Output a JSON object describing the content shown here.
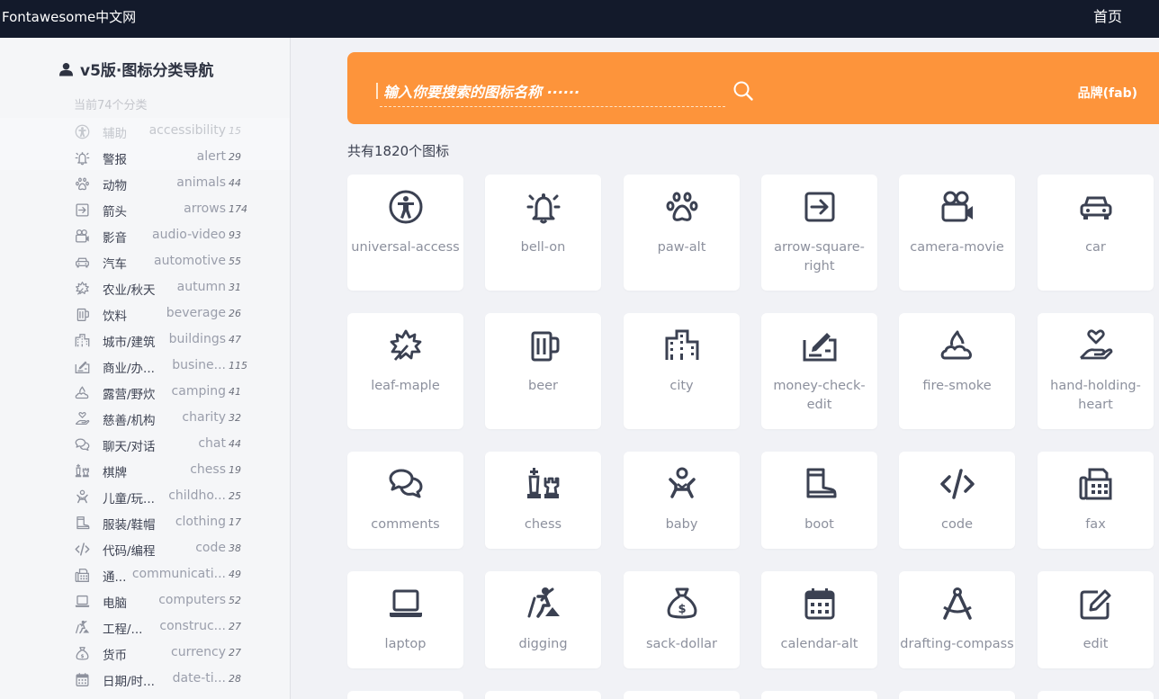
{
  "header": {
    "brand": "Fontawesome中文网",
    "home": "首页"
  },
  "sidebar": {
    "title": "v5版·图标分类导航",
    "count_label": "当前74个分类",
    "categories": [
      {
        "cn": "辅助",
        "en": "accessibility",
        "count": "15",
        "icon": "universal-access-icon"
      },
      {
        "cn": "警报",
        "en": "alert",
        "count": "29",
        "icon": "bell-icon"
      },
      {
        "cn": "动物",
        "en": "animals",
        "count": "44",
        "icon": "paw-icon"
      },
      {
        "cn": "箭头",
        "en": "arrows",
        "count": "174",
        "icon": "arrow-square-right-icon"
      },
      {
        "cn": "影音",
        "en": "audio-video",
        "count": "93",
        "icon": "camera-movie-icon"
      },
      {
        "cn": "汽车",
        "en": "automotive",
        "count": "55",
        "icon": "car-icon"
      },
      {
        "cn": "农业/秋天",
        "en": "autumn",
        "count": "31",
        "icon": "leaf-maple-icon"
      },
      {
        "cn": "饮料",
        "en": "beverage",
        "count": "26",
        "icon": "beer-icon"
      },
      {
        "cn": "城市/建筑",
        "en": "buildings",
        "count": "47",
        "icon": "city-icon"
      },
      {
        "cn": "商业/办...",
        "en": "busine...",
        "count": "115",
        "icon": "money-check-edit-icon"
      },
      {
        "cn": "露营/野炊",
        "en": "camping",
        "count": "41",
        "icon": "fire-smoke-icon"
      },
      {
        "cn": "慈善/机构",
        "en": "charity",
        "count": "32",
        "icon": "hand-holding-heart-icon"
      },
      {
        "cn": "聊天/对话",
        "en": "chat",
        "count": "44",
        "icon": "comments-icon"
      },
      {
        "cn": "棋牌",
        "en": "chess",
        "count": "19",
        "icon": "chess-icon"
      },
      {
        "cn": "儿童/玩...",
        "en": "childho...",
        "count": "25",
        "icon": "baby-icon"
      },
      {
        "cn": "服装/鞋帽",
        "en": "clothing",
        "count": "17",
        "icon": "boot-icon"
      },
      {
        "cn": "代码/编程",
        "en": "code",
        "count": "38",
        "icon": "code-icon"
      },
      {
        "cn": "通...",
        "en": "communicati...",
        "count": "49",
        "icon": "fax-icon"
      },
      {
        "cn": "电脑",
        "en": "computers",
        "count": "52",
        "icon": "laptop-icon"
      },
      {
        "cn": "工程/...",
        "en": "construc...",
        "count": "27",
        "icon": "digging-icon"
      },
      {
        "cn": "货币",
        "en": "currency",
        "count": "27",
        "icon": "sack-dollar-icon"
      },
      {
        "cn": "日期/时...",
        "en": "date-ti...",
        "count": "28",
        "icon": "calendar-alt-icon"
      }
    ]
  },
  "search": {
    "placeholder": "输入你要搜索的图标名称 ······",
    "brand_filter": "品牌(fab)"
  },
  "total_label": "共有1820个图标",
  "icons": [
    {
      "name": "universal-access",
      "icon": "universal-access-icon"
    },
    {
      "name": "bell-on",
      "icon": "bell-icon"
    },
    {
      "name": "paw-alt",
      "icon": "paw-icon"
    },
    {
      "name": "arrow-square-right",
      "icon": "arrow-square-right-icon"
    },
    {
      "name": "camera-movie",
      "icon": "camera-movie-icon"
    },
    {
      "name": "car",
      "icon": "car-icon"
    },
    {
      "name": "leaf-maple",
      "icon": "leaf-maple-icon"
    },
    {
      "name": "beer",
      "icon": "beer-icon"
    },
    {
      "name": "city",
      "icon": "city-icon"
    },
    {
      "name": "money-check-edit",
      "icon": "money-check-edit-icon"
    },
    {
      "name": "fire-smoke",
      "icon": "fire-smoke-icon"
    },
    {
      "name": "hand-holding-heart",
      "icon": "hand-holding-heart-icon"
    },
    {
      "name": "comments",
      "icon": "comments-icon"
    },
    {
      "name": "chess",
      "icon": "chess-icon"
    },
    {
      "name": "baby",
      "icon": "baby-icon"
    },
    {
      "name": "boot",
      "icon": "boot-icon"
    },
    {
      "name": "code",
      "icon": "code-icon"
    },
    {
      "name": "fax",
      "icon": "fax-icon"
    },
    {
      "name": "laptop",
      "icon": "laptop-icon"
    },
    {
      "name": "digging",
      "icon": "digging-icon"
    },
    {
      "name": "sack-dollar",
      "icon": "sack-dollar-icon"
    },
    {
      "name": "calendar-alt",
      "icon": "calendar-alt-icon"
    },
    {
      "name": "drafting-compass",
      "icon": "drafting-compass-icon"
    },
    {
      "name": "edit",
      "icon": "edit-icon"
    }
  ],
  "colors": {
    "topbar": "#131a2b",
    "accent": "#fd943b",
    "icon": "#3b4152",
    "label": "#8c909d"
  }
}
